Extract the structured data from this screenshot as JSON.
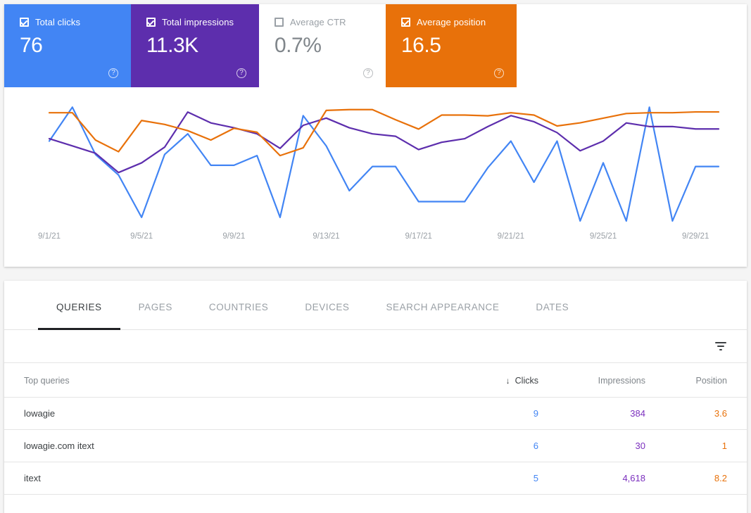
{
  "metrics": [
    {
      "label": "Total clicks",
      "value": "76",
      "checked": true,
      "help": "?",
      "color": "#4285f4"
    },
    {
      "label": "Total impressions",
      "value": "11.3K",
      "checked": true,
      "help": "?",
      "color": "#5d2ead"
    },
    {
      "label": "Average CTR",
      "value": "0.7%",
      "checked": false,
      "help": "?",
      "color": "#ffffff"
    },
    {
      "label": "Average position",
      "value": "16.5",
      "checked": true,
      "help": "?",
      "color": "#e8710a"
    }
  ],
  "tabs": [
    {
      "label": "QUERIES",
      "active": true
    },
    {
      "label": "PAGES",
      "active": false
    },
    {
      "label": "COUNTRIES",
      "active": false
    },
    {
      "label": "DEVICES",
      "active": false
    },
    {
      "label": "SEARCH APPEARANCE",
      "active": false
    },
    {
      "label": "DATES",
      "active": false
    }
  ],
  "toolbar": {
    "filter_icon": "filter-icon"
  },
  "table": {
    "headers": {
      "queries": "Top queries",
      "clicks": "Clicks",
      "impressions": "Impressions",
      "position": "Position"
    },
    "sort_indicator": "↓",
    "rows": [
      {
        "query": "lowagie",
        "clicks": "9",
        "impressions": "384",
        "position": "3.6"
      },
      {
        "query": "lowagie.com itext",
        "clicks": "6",
        "impressions": "30",
        "position": "1"
      },
      {
        "query": "itext",
        "clicks": "5",
        "impressions": "4,618",
        "position": "8.2"
      }
    ]
  },
  "chart_data": {
    "type": "line",
    "title": "",
    "xlabel": "",
    "ylabel": "",
    "grid": false,
    "legend_position": "none",
    "x": [
      "9/1/21",
      "9/2/21",
      "9/3/21",
      "9/4/21",
      "9/5/21",
      "9/6/21",
      "9/7/21",
      "9/8/21",
      "9/9/21",
      "9/10/21",
      "9/11/21",
      "9/12/21",
      "9/13/21",
      "9/14/21",
      "9/15/21",
      "9/16/21",
      "9/17/21",
      "9/18/21",
      "9/19/21",
      "9/20/21",
      "9/21/21",
      "9/22/21",
      "9/23/21",
      "9/24/21",
      "9/25/21",
      "9/26/21",
      "9/27/21",
      "9/28/21",
      "9/29/21",
      "9/30/21"
    ],
    "tick_labels": [
      "9/1/21",
      "9/5/21",
      "9/9/21",
      "9/13/21",
      "9/17/21",
      "9/21/21",
      "9/25/21",
      "9/29/21"
    ],
    "tick_indices": [
      0,
      4,
      8,
      12,
      16,
      20,
      24,
      28
    ],
    "series": [
      {
        "name": "Total clicks",
        "color": "#4285f4",
        "values": [
          4,
          9,
          3,
          2,
          0,
          4,
          5,
          3,
          3,
          4,
          0,
          9,
          5,
          1,
          3,
          3,
          1,
          1,
          1,
          3,
          5,
          2,
          5,
          0,
          3,
          0,
          9,
          0,
          3,
          3
        ]
      },
      {
        "name": "Total impressions",
        "color": "#5d2ead",
        "values": [
          430,
          400,
          370,
          300,
          340,
          400,
          560,
          520,
          500,
          480,
          420,
          520,
          540,
          500,
          480,
          460,
          400,
          430,
          450,
          500,
          540,
          510,
          470,
          400,
          440,
          520,
          500,
          500,
          495,
          495
        ]
      },
      {
        "name": "Average position",
        "color": "#e8710a",
        "values": [
          16.5,
          16.5,
          13.0,
          11.5,
          15.5,
          15.0,
          14.2,
          13.0,
          14.5,
          14.0,
          11.0,
          12.0,
          16.8,
          16.9,
          16.9,
          15.6,
          14.4,
          16.2,
          16.2,
          16.1,
          16.5,
          16.2,
          14.8,
          15.2,
          15.8,
          16.4,
          16.5,
          16.5,
          16.6,
          16.6
        ]
      }
    ],
    "series_pixel_paths": {
      "note": "normalized 0-1 vertical positions used for rendering, top=0",
      "Total clicks": [
        0.34,
        0.06,
        0.45,
        0.62,
        0.97,
        0.45,
        0.28,
        0.54,
        0.54,
        0.46,
        0.97,
        0.13,
        0.38,
        0.75,
        0.55,
        0.55,
        0.84,
        0.84,
        0.84,
        0.56,
        0.34,
        0.68,
        0.34,
        1.0,
        0.52,
        1.0,
        0.06,
        1.0,
        0.55,
        0.55
      ],
      "Total impressions": [
        0.32,
        0.38,
        0.44,
        0.6,
        0.52,
        0.39,
        0.1,
        0.19,
        0.23,
        0.28,
        0.4,
        0.21,
        0.15,
        0.23,
        0.28,
        0.3,
        0.41,
        0.35,
        0.32,
        0.22,
        0.13,
        0.18,
        0.27,
        0.42,
        0.34,
        0.19,
        0.22,
        0.22,
        0.24,
        0.24
      ]
    },
    "xlim": [
      "9/1/21",
      "9/30/21"
    ]
  }
}
